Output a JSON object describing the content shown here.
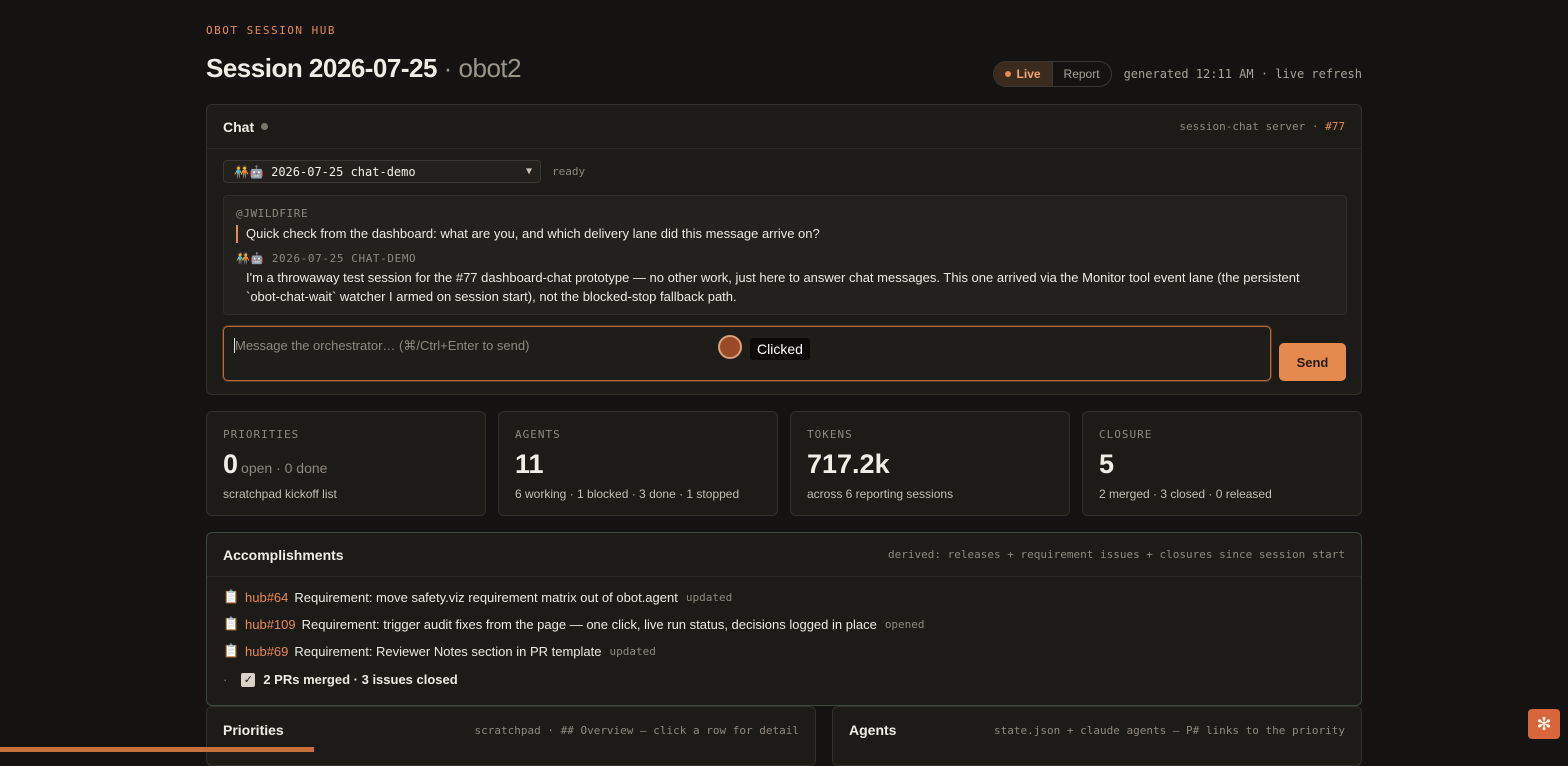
{
  "header": {
    "eyebrow": "OBOT SESSION HUB",
    "title": "Session 2026-07-25",
    "title_sub": "· obot2",
    "mode_live": "Live",
    "mode_report": "Report",
    "generated": "generated 12:11 AM · live refresh"
  },
  "chat": {
    "title": "Chat",
    "meta_prefix": "session-chat server ·",
    "meta_ref": "#77",
    "session_select": "🧑‍🤝‍🧑🤖 2026-07-25 chat-demo",
    "status": "ready",
    "messages": [
      {
        "author": "@JWILDFIRE",
        "text": "Quick check from the dashboard: what are you, and which delivery lane did this message arrive on?"
      },
      {
        "author": "🧑‍🤝‍🧑🤖 2026-07-25 CHAT-DEMO",
        "text": "I'm a throwaway test session for the #77 dashboard-chat prototype — no other work, just here to answer chat messages. This one arrived via the Monitor tool event lane (the persistent `obot-chat-wait` watcher I armed on session start), not the blocked-stop fallback path."
      }
    ],
    "placeholder": "Message the orchestrator…  (⌘/Ctrl+Enter to send)",
    "send_label": "Send",
    "click_label": "Clicked"
  },
  "stats": [
    {
      "label": "PRIORITIES",
      "value": "0",
      "rest": "open · 0 done",
      "foot": "scratchpad kickoff list"
    },
    {
      "label": "AGENTS",
      "value": "11",
      "rest": "",
      "foot": "6 working · 1 blocked · 3 done · 1 stopped"
    },
    {
      "label": "TOKENS",
      "value": "717.2k",
      "rest": "",
      "foot": "across 6 reporting sessions"
    },
    {
      "label": "CLOSURE",
      "value": "5",
      "rest": "",
      "foot": "2 merged · 3 closed · 0 released"
    }
  ],
  "accomplishments": {
    "title": "Accomplishments",
    "meta": "derived: releases + requirement issues + closures since session start",
    "items": [
      {
        "icon": "📋",
        "ref": "hub#64",
        "text": "Requirement: move safety.viz requirement matrix out of obot.agent",
        "status": "updated"
      },
      {
        "icon": "📋",
        "ref": "hub#109",
        "text": "Requirement: trigger audit fixes from the page — one click, live run status, decisions logged in place",
        "status": "opened"
      },
      {
        "icon": "📋",
        "ref": "hub#69",
        "text": "Requirement: Reviewer Notes section in PR template",
        "status": "updated"
      }
    ],
    "summary_bullet": "·",
    "summary_check": "✓",
    "summary": "2 PRs merged · 3 issues closed"
  },
  "priorities": {
    "title": "Priorities",
    "meta": "scratchpad · ## Overview — click a row for detail"
  },
  "agents": {
    "title": "Agents",
    "meta": "state.json + claude agents — P# links to the priority"
  },
  "colors": {
    "accent": "#e58a4e",
    "background": "#141311",
    "card": "#1d1b18"
  }
}
